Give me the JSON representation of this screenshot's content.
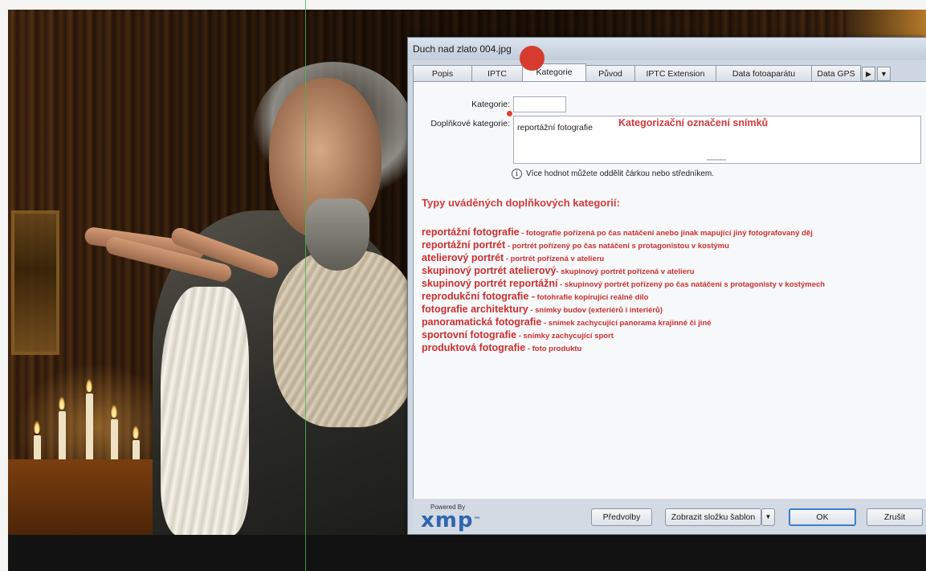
{
  "window": {
    "title": "Duch nad zlato 004.jpg"
  },
  "tabs": [
    {
      "label": "Popis"
    },
    {
      "label": "IPTC"
    },
    {
      "label": "Kategorie",
      "active": true
    },
    {
      "label": "Původ"
    },
    {
      "label": "IPTC Extension"
    },
    {
      "label": "Data fotoaparátu"
    },
    {
      "label": "Data GPS"
    }
  ],
  "tab_scroll": {
    "next_icon": "▶",
    "menu_icon": "▼"
  },
  "form": {
    "kategorie_label": "Kategorie:",
    "kategorie_value": "",
    "doplnkove_label": "Doplňkové kategorie:",
    "doplnkove_value": "reportážní fotografie",
    "annotation": "Kategorizační označení snímků",
    "hint_icon": "i",
    "hint": "Více hodnot můžete oddělit čárkou nebo středníkem."
  },
  "types": {
    "heading": "Typy uváděných doplňkových kategorií:",
    "items": [
      {
        "name": "reportážní fotografie",
        "desc": " -  fotografie pořízená po čas natáčení anebo jinak mapující jiný fotografovaný děj"
      },
      {
        "name": "reportážní portrét",
        "desc": " - portrét pořízený po čas natáčení s protagonistou v kostýmu"
      },
      {
        "name": "atelierový portrét",
        "desc": " - portrét pořízená v atelieru"
      },
      {
        "name": "skupinový portrét atelierový",
        "desc": "- skupinový portrét pořízená v atelieru"
      },
      {
        "name": "skupinový portrét reportážní",
        "desc": " - skupinový portrét pořízený po čas natáčení s protagonisty v kostýmech"
      },
      {
        "name": "reprodukční fotografie -",
        "desc": " fotohrafie kopírující reálné dílo"
      },
      {
        "name": "fotografie architektury",
        "desc": " - snímky budov (exteriérů i  interiérů)"
      },
      {
        "name": "panoramatická fotografie",
        "desc": " - snímek zachycující panorama krajinné či jiné"
      },
      {
        "name": "sportovní fotografie",
        "desc": " - snímky zachycující sport"
      },
      {
        "name": "produktová fotografie",
        "desc": " - foto produktu"
      }
    ]
  },
  "footer": {
    "powered_by": "Powered By",
    "logo": "xmp",
    "logo_tm": "™",
    "predvolby": "Předvolby",
    "zobrazit": "Zobrazit složku šablon",
    "dropdown_icon": "▼",
    "ok": "OK",
    "zrusit": "Zrušit"
  },
  "colors": {
    "accent_red": "#d13a3a",
    "record_dot": "#d63b2f",
    "xmp_blue": "#2f66b0",
    "ok_border": "#3f7ed0"
  }
}
